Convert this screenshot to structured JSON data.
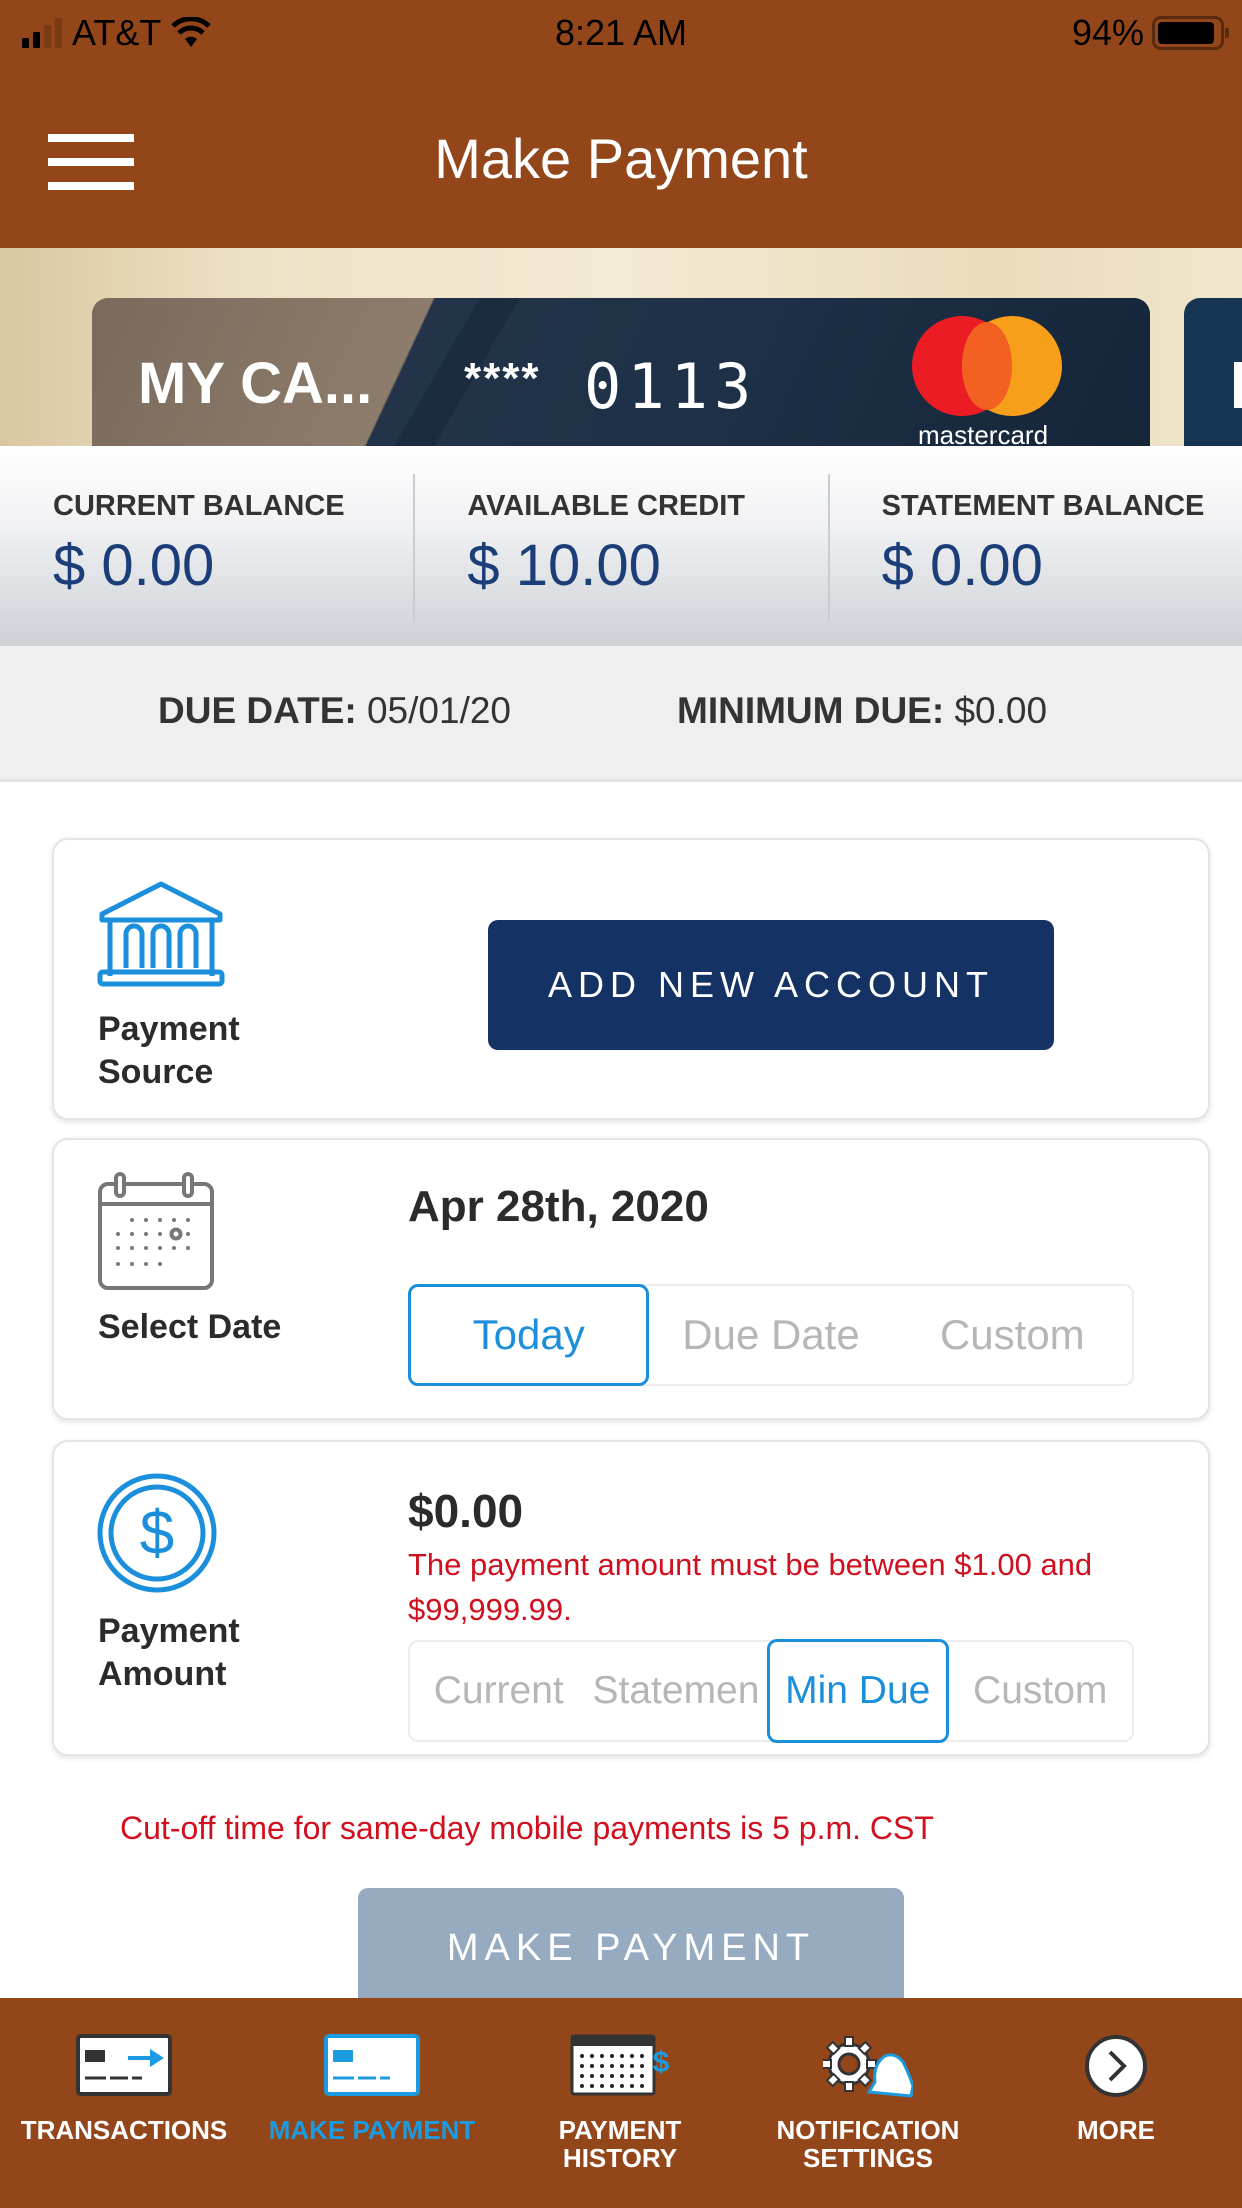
{
  "status_bar": {
    "carrier": "AT&T",
    "time": "8:21 AM",
    "battery_percent": "94%",
    "battery_level": 0.94,
    "signal_bars_filled": 2,
    "signal_bars_total": 4
  },
  "header": {
    "title": "Make Payment",
    "menu_icon": "hamburger-icon"
  },
  "card": {
    "name": "MY CA...",
    "masked": "****",
    "last4": "0113",
    "network": "mastercard"
  },
  "balances": [
    {
      "label": "CURRENT BALANCE",
      "value": "$ 0.00"
    },
    {
      "label": "AVAILABLE CREDIT",
      "value": "$ 10.00"
    },
    {
      "label": "STATEMENT BALANCE",
      "value": "$ 0.00"
    }
  ],
  "due": {
    "due_date_label": "DUE DATE:",
    "due_date_value": "05/01/20",
    "min_due_label": "MINIMUM DUE:",
    "min_due_value": "$0.00"
  },
  "payment_source": {
    "label": "Payment Source",
    "icon": "bank-icon",
    "button": "ADD NEW ACCOUNT"
  },
  "select_date": {
    "label": "Select Date",
    "icon": "calendar-icon",
    "value": "Apr 28th, 2020",
    "options": [
      "Today",
      "Due Date",
      "Custom"
    ],
    "selected": "Today"
  },
  "payment_amount": {
    "label": "Payment Amount",
    "icon": "dollar-coin-icon",
    "value": "$0.00",
    "error": "The payment amount must be between $1.00 and $99,999.99.",
    "options": [
      "Current",
      "Statemen",
      "Min Due",
      "Custom"
    ],
    "selected": "Min Due"
  },
  "cutoff_notice": "Cut-off time for same-day mobile payments is 5 p.m. CST",
  "make_payment_button": "MAKE PAYMENT",
  "tabbar": {
    "items": [
      {
        "label": "TRANSACTIONS",
        "icon": "transactions-card-icon",
        "active": false
      },
      {
        "label": "MAKE PAYMENT",
        "icon": "make-payment-card-icon",
        "active": true
      },
      {
        "label": "PAYMENT HISTORY",
        "icon": "calendar-dollar-icon",
        "active": false
      },
      {
        "label": "NOTIFICATION SETTINGS",
        "icon": "gear-bell-icon",
        "active": false
      },
      {
        "label": "MORE",
        "icon": "chevron-right-circle-icon",
        "active": false
      }
    ]
  },
  "colors": {
    "brand": "#93461a",
    "navy": "#153265",
    "accent_blue": "#1b8fdc",
    "error_red": "#d0101f",
    "balance_value": "#1b3d78",
    "disabled_button": "#97abc0"
  }
}
